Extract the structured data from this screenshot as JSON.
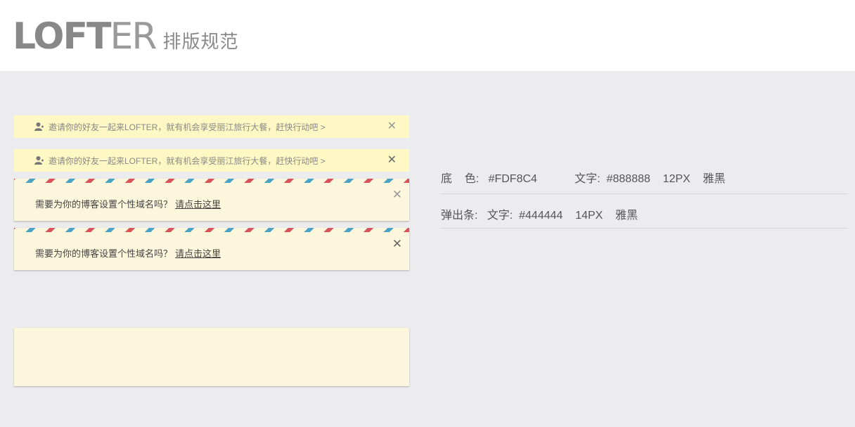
{
  "header": {
    "logo_bold": "LOF",
    "logo_mid": "T",
    "logo_thin": "ER",
    "subtitle": "排版规范"
  },
  "notice_bars": [
    {
      "icon": "user-icon",
      "text": "邀请你的好友一起来LOFTER，就有机会享受丽江旅行大餐，赶快行动吧 >",
      "close": "✕"
    },
    {
      "icon": "user-icon",
      "text": "邀请你的好友一起来LOFTER，就有机会享受丽江旅行大餐，赶快行动吧 >",
      "close": "✕"
    }
  ],
  "popups": [
    {
      "text": "需要为你的博客设置个性域名吗？",
      "link": "请点击这里",
      "close": "✕"
    },
    {
      "text": "需要为你的博客设置个性域名吗？",
      "link": "请点击这里",
      "close": "✕"
    }
  ],
  "spec": {
    "line1": "底    色:   #FDF8C4            文字:  #888888    12PX    雅黑",
    "line2": "弹出条:   文字:  #444444    14PX    雅黑"
  },
  "colors": {
    "bar_bg": "#FDF8C4",
    "bar_text": "#888888",
    "popup_text": "#444444",
    "stripe_red": "#d9545a",
    "stripe_blue": "#4aa3c4"
  }
}
